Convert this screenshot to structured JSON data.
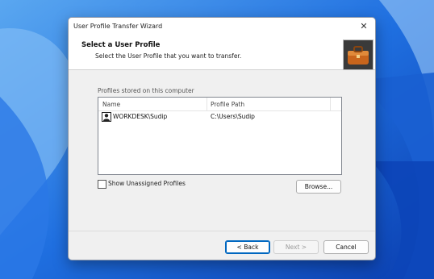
{
  "dialog": {
    "window_title": "User Profile Transfer Wizard",
    "close_glyph": "✕",
    "header_title": "Select a User Profile",
    "header_subtitle": "Select the User Profile that you want to transfer.",
    "profiles_label": "Profiles stored on this computer",
    "columns": {
      "name": "Name",
      "path": "Profile Path"
    },
    "profiles": [
      {
        "name": "WORKDESK\\Sudip",
        "path": "C:\\Users\\Sudip",
        "icon": "user-icon"
      }
    ],
    "show_unassigned_label": "Show Unassigned Profiles",
    "show_unassigned_checked": false,
    "browse_button": "Browse...",
    "back_button": "< Back",
    "next_button": "Next >",
    "cancel_button": "Cancel",
    "header_icon": "briefcase-icon",
    "accent_color": "#0067c0"
  }
}
